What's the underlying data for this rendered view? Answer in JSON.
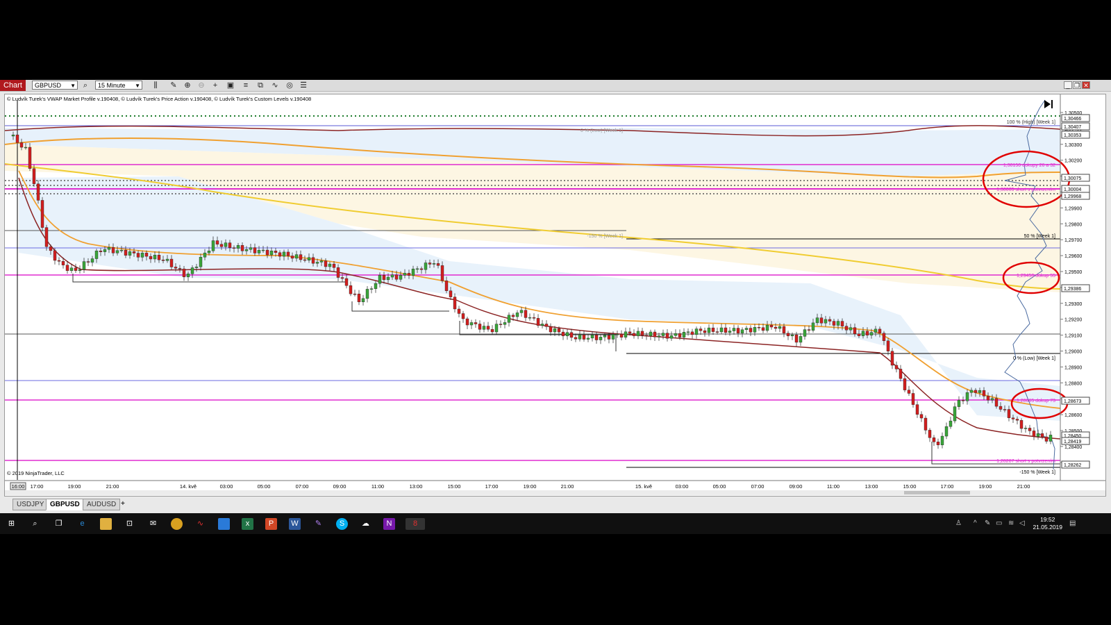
{
  "toolbar": {
    "title": "Chart",
    "instrument": "GBPUSD",
    "interval": "15 Minute"
  },
  "chart": {
    "credits": "© Ludvík Turek's VWAP Market Profile v.190408, © Ludvík Turek's Price Action v.190408, © Ludvík Turek's Custom Levels v.190408",
    "copyright": "© 2019 NinjaTrader, LLC",
    "price_ticks": [
      "1,30500",
      "1,30400",
      "1,30300",
      "1,30200",
      "1,30100",
      "1,30000",
      "1,29900",
      "1,29800",
      "1,29700",
      "1,29600",
      "1,29500",
      "1,29400",
      "1,29300",
      "1,29200",
      "1,29100",
      "1,29000",
      "1,28900",
      "1,28800",
      "1,28700",
      "1,28600",
      "1,28500",
      "1,28400",
      "1,28300"
    ],
    "price_markers": [
      "1,30466",
      "1,30407",
      "1,30353",
      "1,30075",
      "1,30004",
      "1,29968",
      "1,29386",
      "1,28673",
      "1,28450",
      "1,28419",
      "1,28262"
    ],
    "time_labels": [
      "16:00",
      "17:00",
      "19:00",
      "21:00",
      "14. kvě",
      "03:00",
      "05:00",
      "07:00",
      "09:00",
      "11:00",
      "13:00",
      "15:00",
      "17:00",
      "19:00",
      "21:00",
      "15. kvě",
      "03:00",
      "05:00",
      "07:00",
      "09:00",
      "11:00",
      "13:00",
      "15:00",
      "17:00",
      "19:00",
      "21:00"
    ],
    "level_labels": {
      "top_high": "100 % (High) [Week 1]",
      "low_week_top": "0 % (Low) [Week 1]",
      "pink_top": "1,30150 dokupy 26 a 32",
      "pink_second": "1,30005 short s potvrzením",
      "minus150_left": "-150 % [Week 1]",
      "fifty": "50 % [Week 1]",
      "pink_mid": "1,29450 dokup 55",
      "low_week": "0 % (Low) [Week 1]",
      "pink_low": "1,28665 dokup 73",
      "pink_bottom": "1,28287 short s potvrzením",
      "minus150_right": "-150 % [Week 1]"
    }
  },
  "tabs": [
    "USDJPY",
    "GBPUSD",
    "AUDUSD",
    "+"
  ],
  "taskbar": {
    "time": "19:52",
    "date": "21.05.2019"
  },
  "colors": {
    "title_bg": "#b0191e",
    "magenta": "#e02bd0",
    "bull": "#3aa53a",
    "bear": "#d21f1f",
    "vwap_orange": "#f0a030",
    "yellow": "#f0cc30",
    "maroon": "#8b2323",
    "annotation_red": "#e00000"
  }
}
